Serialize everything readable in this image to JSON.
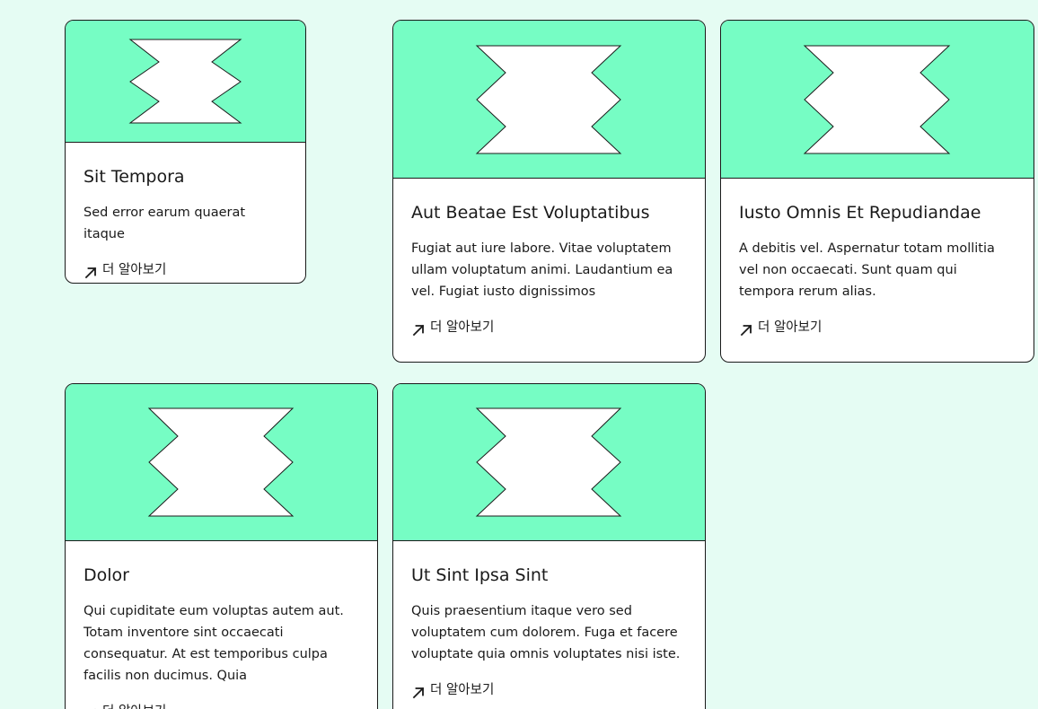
{
  "colors": {
    "page_background": "#e5fcf3",
    "card_image_background": "#76fdc4",
    "card_background": "#ffffff",
    "border": "#1a1a1a"
  },
  "link_icon": "arrow-up-right-icon",
  "image_icon": "banner-shape-icon",
  "cards": [
    {
      "title": "Sit Tempora",
      "description": "Sed error earum quaerat itaque",
      "link_label": "더 알아보기"
    },
    {
      "title": "Aut Beatae Est Voluptatibus",
      "description": "Fugiat aut iure labore. Vitae voluptatem ullam voluptatum animi. Laudantium ea vel. Fugiat iusto dignissimos",
      "link_label": "더 알아보기"
    },
    {
      "title": "Iusto Omnis Et Repudiandae",
      "description": "A debitis vel. Aspernatur totam mollitia vel non occaecati. Sunt quam qui tempora rerum alias.",
      "link_label": "더 알아보기"
    },
    {
      "title": "Dolor",
      "description": "Qui cupiditate eum voluptas autem aut. Totam inventore sint occaecati consequatur. At est temporibus culpa facilis non ducimus. Quia",
      "link_label": "더 알아보기"
    },
    {
      "title": "Ut Sint Ipsa Sint",
      "description": "Quis praesentium itaque vero sed voluptatem cum dolorem. Fuga et facere voluptate quia omnis voluptates nisi iste.",
      "link_label": "더 알아보기"
    }
  ]
}
